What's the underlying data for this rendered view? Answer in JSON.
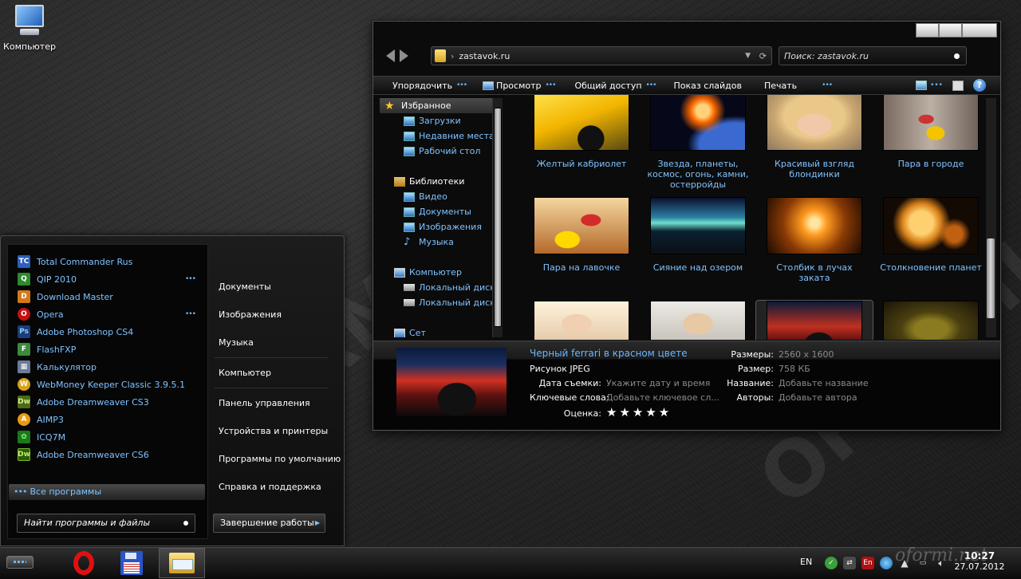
{
  "desktop": {
    "icon_label": "Компьютер"
  },
  "explorer": {
    "address": "zastavok.ru",
    "search_placeholder": "Поиск: zastavok.ru",
    "commands": [
      "Упорядочить",
      "Просмотр",
      "Общий доступ",
      "Показ слайдов",
      "Печать"
    ],
    "nav": {
      "favorites": "Избранное",
      "favorites_items": [
        "Загрузки",
        "Недавние места",
        "Рабочий стол"
      ],
      "libraries": "Библиотеки",
      "libraries_items": [
        "Видео",
        "Документы",
        "Изображения",
        "Музыка"
      ],
      "computer": "Компьютер",
      "computer_items": [
        "Локальный диск (",
        "Локальный диск ("
      ],
      "network_partial": "Сет"
    },
    "items": [
      "Желтый кабриолет",
      "Звезда, планеты, космос, огонь, камни, остерройды",
      "Красивый взгляд блондинки",
      "Пара в городе",
      "Пара на лавочке",
      "Сияние над озером",
      "Столбик в лучах заката",
      "Столкновение планет",
      "",
      "",
      "",
      ""
    ],
    "details": {
      "name": "Черный ferrari в красном цвете",
      "type": "Рисунок JPEG",
      "date_label": "Дата съемки:",
      "date_value": "Укажите дату и время",
      "keywords_label": "Ключевые слова:",
      "keywords_value": "Добавьте ключевое сл...",
      "rating_label": "Оценка:",
      "rating_stars": "★★★★★",
      "dims_label": "Размеры:",
      "dims_value": "2560 x 1600",
      "size_label": "Размер:",
      "size_value": "758 КБ",
      "title_label": "Название:",
      "title_value": "Добавьте название",
      "authors_label": "Авторы:",
      "authors_value": "Добавьте автора"
    }
  },
  "startmenu": {
    "programs": [
      "Total Commander Rus",
      "QIP 2010",
      "Download Master",
      "Opera",
      "Adobe Photoshop CS4",
      "FlashFXP",
      "Калькулятор",
      "WebMoney Keeper Classic 3.9.5.1",
      "Adobe Dreamweaver CS3",
      "AIMP3",
      "ICQ7M",
      "Adobe Dreamweaver CS6"
    ],
    "program_icons": [
      "TC",
      "Q",
      "D",
      "O",
      "Ps",
      "F",
      "▦",
      "W",
      "Dw",
      "A",
      "✿",
      "Dw"
    ],
    "all_programs": "Все программы",
    "search_placeholder": "Найти программы и файлы",
    "right_items": [
      "Документы",
      "Изображения",
      "Музыка",
      "Компьютер",
      "Панель управления",
      "Устройства и принтеры",
      "Программы по умолчанию",
      "Справка и поддержка"
    ],
    "shutdown": "Завершение работы"
  },
  "taskbar": {
    "lang": "EN",
    "tray_en": "En",
    "time": "10:27",
    "date": "27.07.2012"
  },
  "watermark": {
    "text": "OFORMI.NET",
    "url": "oformi.net"
  }
}
